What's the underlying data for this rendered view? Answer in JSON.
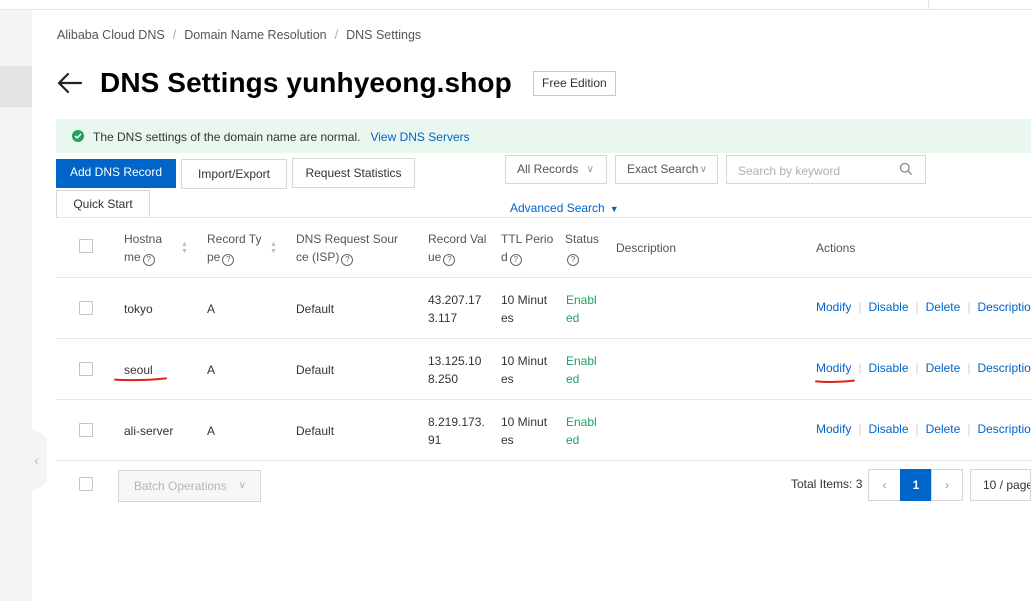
{
  "breadcrumb": [
    "Alibaba Cloud DNS",
    "Domain Name Resolution",
    "DNS Settings"
  ],
  "header": {
    "title": "DNS Settings yunhyeong.shop",
    "edition": "Free Edition"
  },
  "notice": {
    "message": "The DNS settings of the domain name are normal.",
    "link": "View DNS Servers"
  },
  "toolbar": {
    "add_record": "Add DNS Record",
    "import_export": "Import/Export",
    "request_statistics": "Request Statistics",
    "quick_start": "Quick Start",
    "record_filter": "All Records",
    "search_mode": "Exact Search",
    "search_placeholder": "Search by keyword",
    "advanced_search": "Advanced Search"
  },
  "table": {
    "headers": {
      "hostname": [
        "Hostna",
        "me"
      ],
      "record_type": [
        "Record Ty",
        "pe"
      ],
      "dns_source": [
        "DNS Request Sour",
        "ce (ISP)"
      ],
      "record_value": [
        "Record Val",
        "ue"
      ],
      "ttl": [
        "TTL Perio",
        "d"
      ],
      "status": "Status",
      "description": "Description",
      "actions": "Actions"
    },
    "rows": [
      {
        "hostname": "tokyo",
        "type": "A",
        "source": "Default",
        "value": [
          "43.207.17",
          "3.117"
        ],
        "ttl": [
          "10 Minut",
          "es"
        ],
        "status": [
          "Enabl",
          "ed"
        ]
      },
      {
        "hostname": "seoul",
        "type": "A",
        "source": "Default",
        "value": [
          "13.125.10",
          "8.250"
        ],
        "ttl": [
          "10 Minut",
          "es"
        ],
        "status": [
          "Enabl",
          "ed"
        ]
      },
      {
        "hostname": "ali-server",
        "type": "A",
        "source": "Default",
        "value": [
          "8.219.173.",
          "91"
        ],
        "ttl": [
          "10 Minut",
          "es"
        ],
        "status": [
          "Enabl",
          "ed"
        ]
      }
    ],
    "actions": {
      "modify": "Modify",
      "disable": "Disable",
      "delete": "Delete",
      "description": "Description"
    }
  },
  "footer": {
    "batch_operations": "Batch Operations",
    "total_items": "Total Items: 3",
    "current_page": "1",
    "page_size": "10 / page"
  },
  "colors": {
    "primary": "#0064c8",
    "success": "#20a162",
    "annotation": "#e0201a"
  }
}
